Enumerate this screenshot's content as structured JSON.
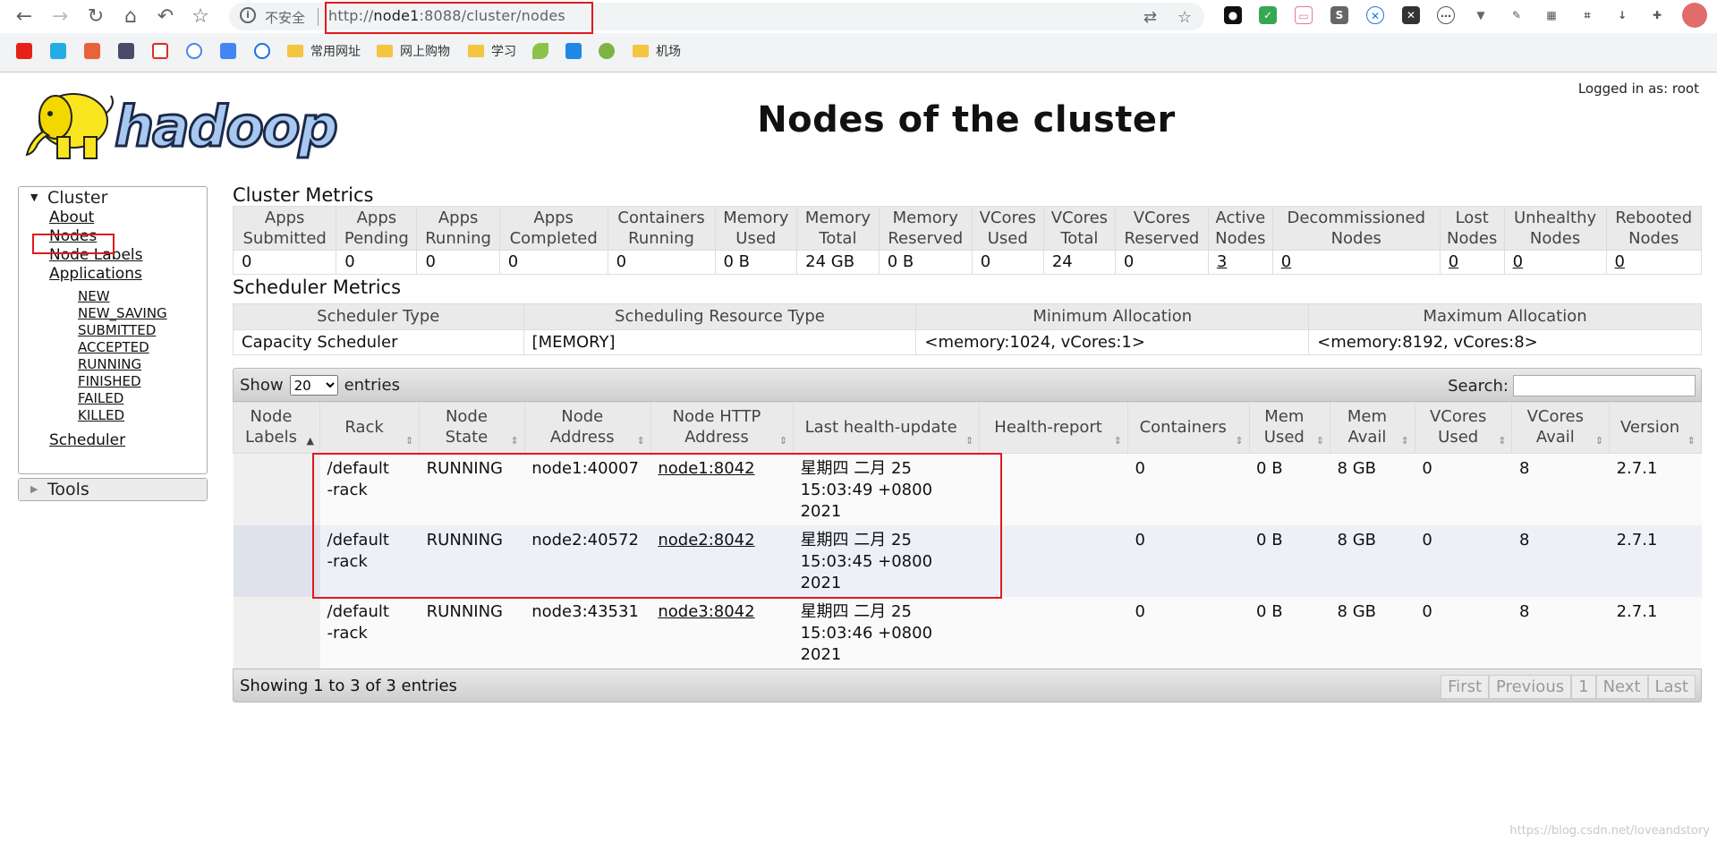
{
  "browser": {
    "insecure_label": "不安全",
    "url_prefix": "http://",
    "url_host": "node1",
    "url_rest": ":8088/cluster/nodes",
    "bookmarks": [
      {
        "label": "",
        "icon": "youtube-icon",
        "color": "#e62117"
      },
      {
        "label": "",
        "icon": "bilibili-tv-icon",
        "color": "#23ade5"
      },
      {
        "label": "",
        "icon": "avatar-icon",
        "color": "#e8623a"
      },
      {
        "label": "",
        "icon": "anime-icon",
        "color": "#4a4a6a"
      },
      {
        "label": "",
        "icon": "gmail-icon",
        "color": "#d93025"
      },
      {
        "label": "",
        "icon": "cloud-icon",
        "color": "#4a86e8"
      },
      {
        "label": "",
        "icon": "translate-icon",
        "color": "#4285f4"
      },
      {
        "label": "",
        "icon": "x-circle-icon",
        "color": "#1a73e8"
      },
      {
        "label": "常用网址",
        "icon": "folder-icon",
        "color": "#f4c542"
      },
      {
        "label": "网上购物",
        "icon": "folder-icon",
        "color": "#f4c542"
      },
      {
        "label": "学习",
        "icon": "folder-icon",
        "color": "#f4c542"
      },
      {
        "label": "",
        "icon": "leaf-icon",
        "color": "#8bc34a"
      },
      {
        "label": "",
        "icon": "p-icon",
        "color": "#1e88e5"
      },
      {
        "label": "",
        "icon": "lime-icon",
        "color": "#7cb342"
      },
      {
        "label": "机场",
        "icon": "folder-icon",
        "color": "#f4c542"
      }
    ]
  },
  "header": {
    "logged_in": "Logged in as: root",
    "logo_text": "hadoop",
    "title": "Nodes of the cluster"
  },
  "sidebar": {
    "cluster_label": "Cluster",
    "about": "About",
    "nodes": "Nodes",
    "node_labels": "Node Labels",
    "applications": "Applications",
    "app_states": [
      "NEW",
      "NEW_SAVING",
      "SUBMITTED",
      "ACCEPTED",
      "RUNNING",
      "FINISHED",
      "FAILED",
      "KILLED"
    ],
    "scheduler": "Scheduler",
    "tools_label": "Tools"
  },
  "cluster_metrics": {
    "heading": "Cluster Metrics",
    "headers": [
      [
        "Apps",
        "Submitted"
      ],
      [
        "Apps",
        "Pending"
      ],
      [
        "Apps",
        "Running"
      ],
      [
        "Apps",
        "Completed"
      ],
      [
        "Containers",
        "Running"
      ],
      [
        "Memory",
        "Used"
      ],
      [
        "Memory",
        "Total"
      ],
      [
        "Memory",
        "Reserved"
      ],
      [
        "VCores",
        "Used"
      ],
      [
        "VCores",
        "Total"
      ],
      [
        "VCores",
        "Reserved"
      ],
      [
        "Active",
        "Nodes"
      ],
      [
        "Decommissioned",
        "Nodes"
      ],
      [
        "Lost",
        "Nodes"
      ],
      [
        "Unhealthy",
        "Nodes"
      ],
      [
        "Rebooted",
        "Nodes"
      ]
    ],
    "values": [
      "0",
      "0",
      "0",
      "0",
      "0",
      "0 B",
      "24 GB",
      "0 B",
      "0",
      "24",
      "0",
      "3",
      "0",
      "0",
      "0",
      "0"
    ]
  },
  "scheduler_metrics": {
    "heading": "Scheduler Metrics",
    "headers": [
      "Scheduler Type",
      "Scheduling Resource Type",
      "Minimum Allocation",
      "Maximum Allocation"
    ],
    "values": [
      "Capacity Scheduler",
      "[MEMORY]",
      "<memory:1024, vCores:1>",
      "<memory:8192, vCores:8>"
    ]
  },
  "nodes_table": {
    "show_label": "Show",
    "entries_label": "entries",
    "page_size": "20",
    "search_label": "Search:",
    "headers": [
      [
        "Node",
        "Labels"
      ],
      [
        "Rack"
      ],
      [
        "Node",
        "State"
      ],
      [
        "Node",
        "Address"
      ],
      [
        "Node HTTP",
        "Address"
      ],
      [
        "Last health-update"
      ],
      [
        "Health-report"
      ],
      [
        "Containers"
      ],
      [
        "Mem",
        "Used"
      ],
      [
        "Mem",
        "Avail"
      ],
      [
        "VCores",
        "Used"
      ],
      [
        "VCores",
        "Avail"
      ],
      [
        "Version"
      ]
    ],
    "rows": [
      {
        "labels": "",
        "rack": "/default-rack",
        "state": "RUNNING",
        "address": "node1:40007",
        "http": "node1:8042",
        "health_update": "星期四 二月 25 15:03:49 +0800 2021",
        "health_report": "",
        "containers": "0",
        "mem_used": "0 B",
        "mem_avail": "8 GB",
        "vcores_used": "0",
        "vcores_avail": "8",
        "version": "2.7.1"
      },
      {
        "labels": "",
        "rack": "/default-rack",
        "state": "RUNNING",
        "address": "node2:40572",
        "http": "node2:8042",
        "health_update": "星期四 二月 25 15:03:45 +0800 2021",
        "health_report": "",
        "containers": "0",
        "mem_used": "0 B",
        "mem_avail": "8 GB",
        "vcores_used": "0",
        "vcores_avail": "8",
        "version": "2.7.1"
      },
      {
        "labels": "",
        "rack": "/default-rack",
        "state": "RUNNING",
        "address": "node3:43531",
        "http": "node3:8042",
        "health_update": "星期四 二月 25 15:03:46 +0800 2021",
        "health_report": "",
        "containers": "0",
        "mem_used": "0 B",
        "mem_avail": "8 GB",
        "vcores_used": "0",
        "vcores_avail": "8",
        "version": "2.7.1"
      }
    ],
    "footer_info": "Showing 1 to 3 of 3 entries",
    "pager": [
      "First",
      "Previous",
      "1",
      "Next",
      "Last"
    ]
  },
  "watermark": "https://blog.csdn.net/loveandstory"
}
